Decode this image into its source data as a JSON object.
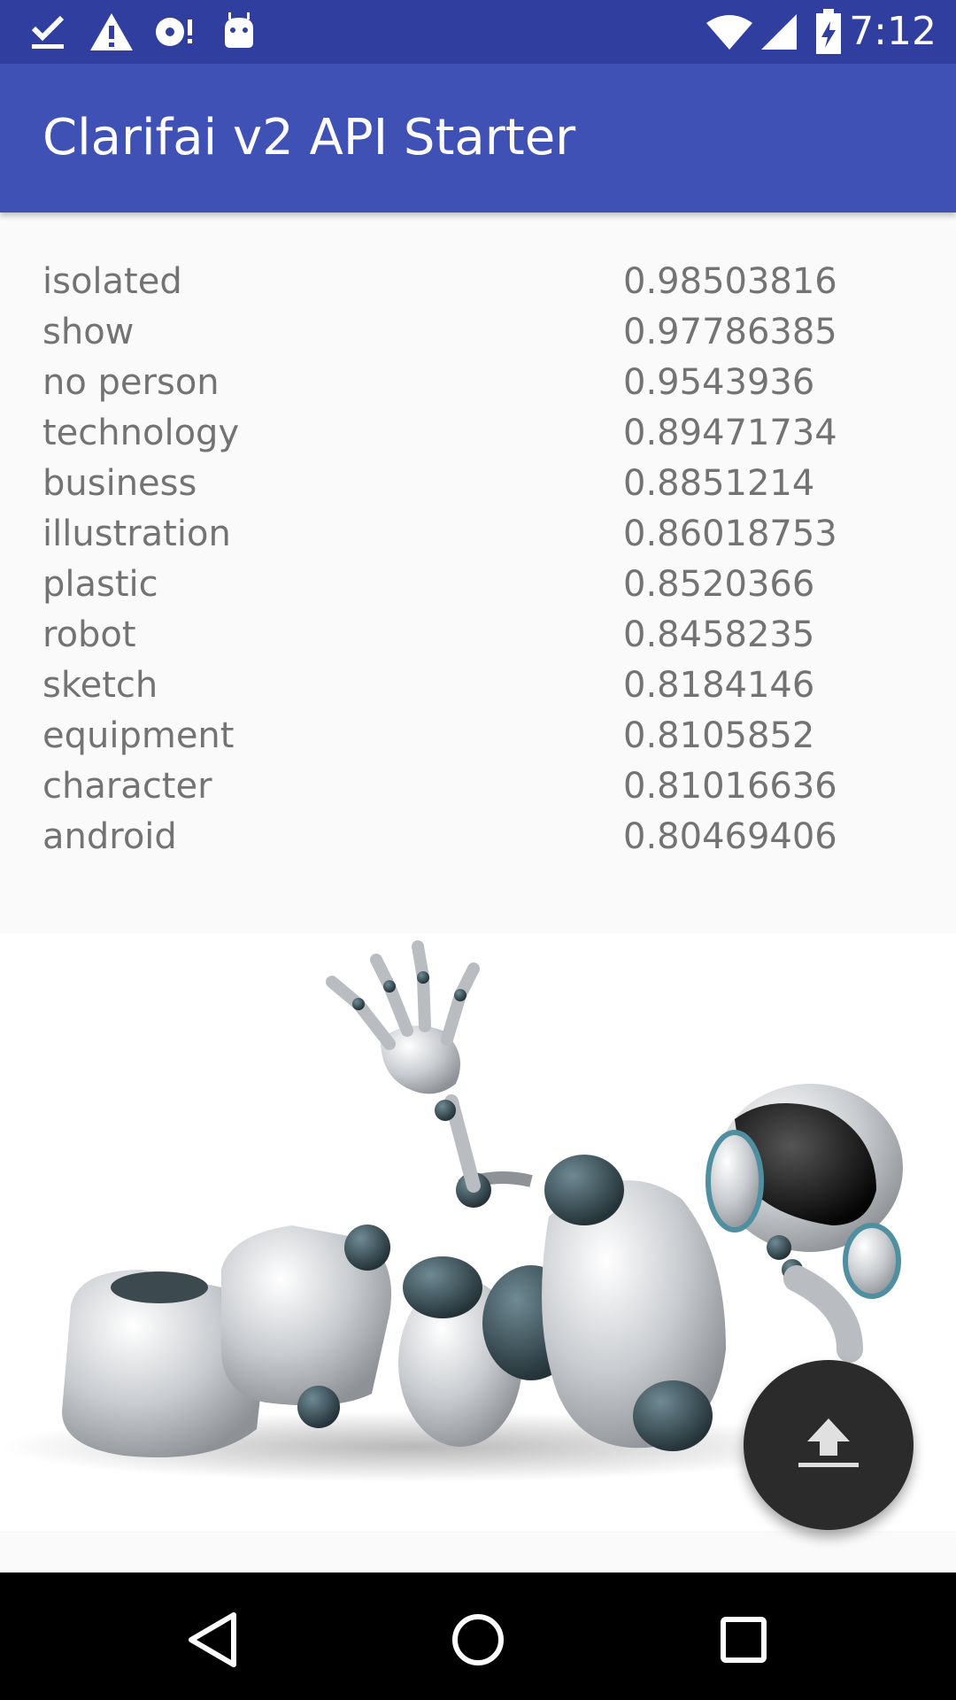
{
  "status_bar": {
    "time": "7:12",
    "left_icons": [
      "check-icon",
      "warning-icon",
      "disc-icon",
      "android-icon"
    ],
    "right_icons": [
      "wifi-icon",
      "signal-icon",
      "battery-icon"
    ],
    "background": "#303f9f"
  },
  "app_bar": {
    "title": "Clarifai v2 API Starter",
    "background": "#3f51b5"
  },
  "results": [
    {
      "concept": "isolated",
      "score": "0.98503816"
    },
    {
      "concept": "show",
      "score": "0.97786385"
    },
    {
      "concept": "no person",
      "score": "0.9543936"
    },
    {
      "concept": "technology",
      "score": "0.89471734"
    },
    {
      "concept": "business",
      "score": "0.8851214"
    },
    {
      "concept": "illustration",
      "score": "0.86018753"
    },
    {
      "concept": "plastic",
      "score": "0.8520366"
    },
    {
      "concept": "robot",
      "score": "0.8458235"
    },
    {
      "concept": "sketch",
      "score": "0.8184146"
    },
    {
      "concept": "equipment",
      "score": "0.8105852"
    },
    {
      "concept": "character",
      "score": "0.81016636"
    },
    {
      "concept": "android",
      "score": "0.80469406"
    }
  ],
  "image": {
    "icon": "robot-image"
  },
  "fab": {
    "icon": "upload-icon",
    "background": "#2b2b2b"
  },
  "nav_bar": {
    "icons": [
      "back-icon",
      "home-icon",
      "recents-icon"
    ]
  }
}
